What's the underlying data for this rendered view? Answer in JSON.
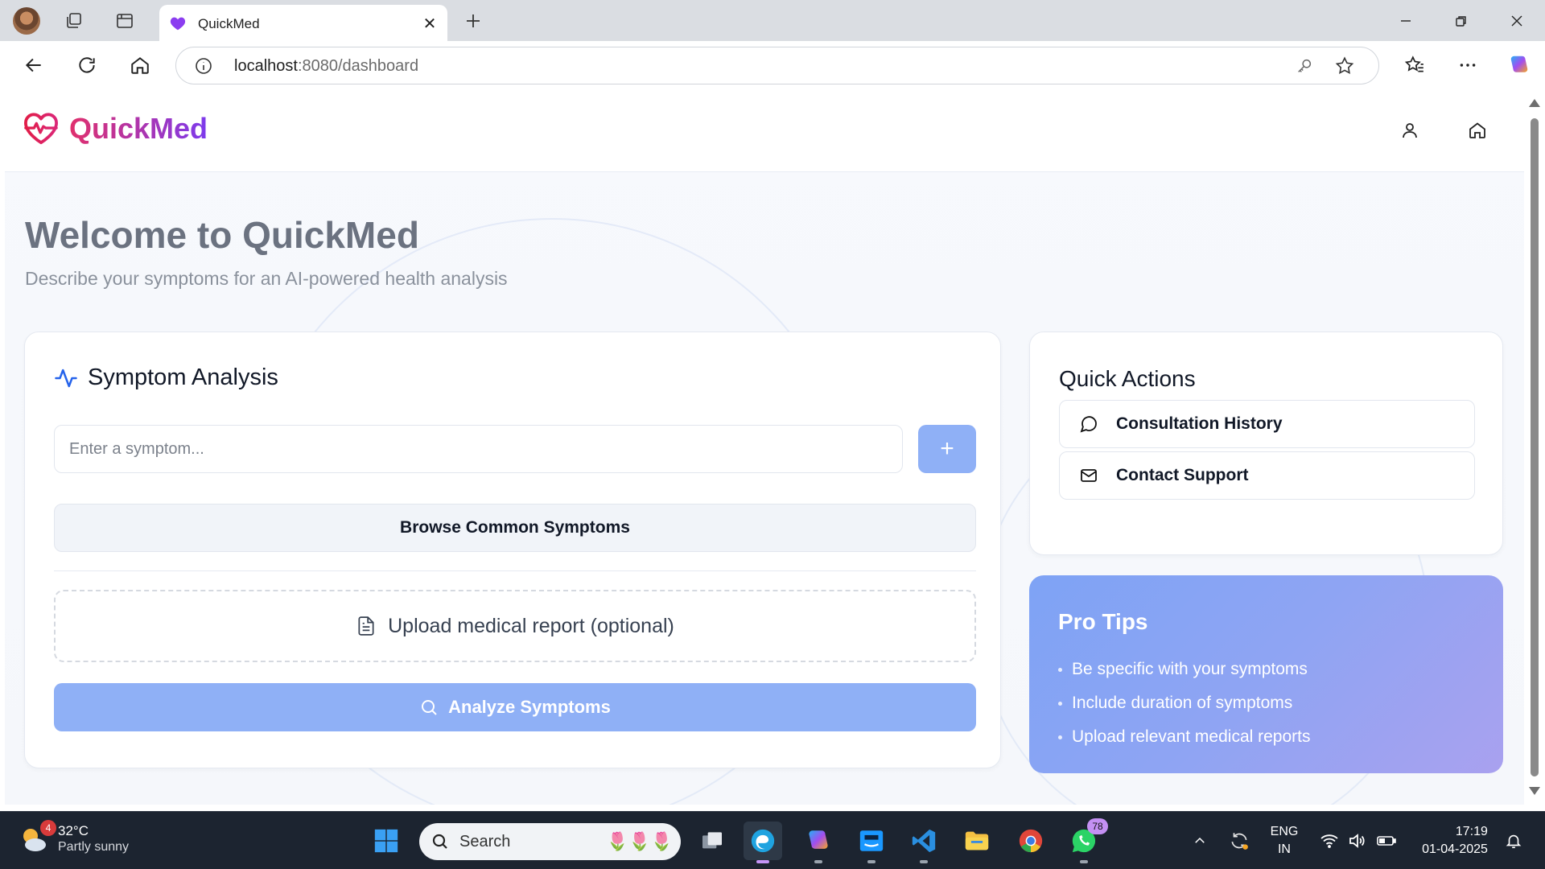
{
  "browser": {
    "tab_title": "QuickMed",
    "url_host": "localhost",
    "url_path": ":8080/dashboard"
  },
  "app": {
    "brand": "QuickMed",
    "welcome_title": "Welcome to QuickMed",
    "welcome_subtitle": "Describe your symptoms for an AI-powered health analysis",
    "brand_colors": [
      "#e1306c",
      "#7c3aed"
    ],
    "accent": "#8fb0f6"
  },
  "symptom_analysis": {
    "title": "Symptom Analysis",
    "input_placeholder": "Enter a symptom...",
    "add_label": "+",
    "browse_label": "Browse Common Symptoms",
    "upload_label": "Upload medical report (optional)",
    "analyze_label": "Analyze Symptoms"
  },
  "quick_actions": {
    "title": "Quick Actions",
    "items": [
      {
        "label": "Consultation History",
        "icon": "message-circle-icon"
      },
      {
        "label": "Contact Support",
        "icon": "mail-icon"
      }
    ]
  },
  "pro_tips": {
    "title": "Pro Tips",
    "items": [
      "Be specific with your symptoms",
      "Include duration of symptoms",
      "Upload relevant medical reports"
    ]
  },
  "taskbar": {
    "weather_badge": "4",
    "temperature": "32°C",
    "condition": "Partly sunny",
    "search_label": "Search",
    "whatsapp_badge": "78",
    "lang_top": "ENG",
    "lang_bottom": "IN",
    "time": "17:19",
    "date": "01-04-2025"
  }
}
